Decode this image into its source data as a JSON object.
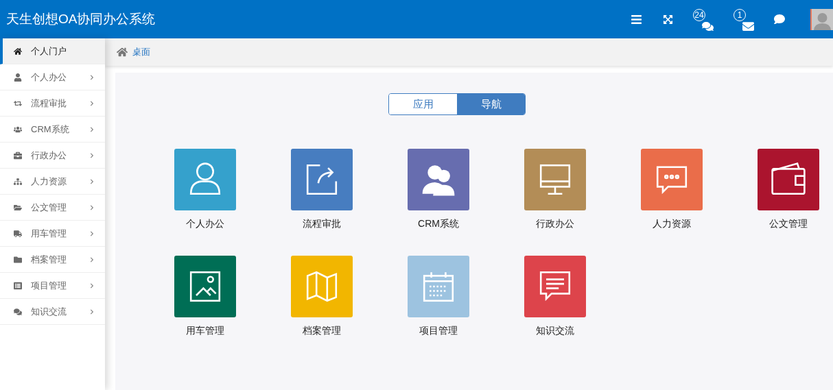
{
  "header": {
    "title": "天生创想OA协同办公系统",
    "badges": [
      {
        "count": "24"
      },
      {
        "count": "1"
      }
    ]
  },
  "sidebar": {
    "items": [
      {
        "label": "个人门户",
        "selected": true,
        "expandable": false
      },
      {
        "label": "个人办公",
        "selected": false,
        "expandable": true
      },
      {
        "label": "流程审批",
        "selected": false,
        "expandable": true
      },
      {
        "label": "CRM系统",
        "selected": false,
        "expandable": true
      },
      {
        "label": "行政办公",
        "selected": false,
        "expandable": true
      },
      {
        "label": "人力资源",
        "selected": false,
        "expandable": true
      },
      {
        "label": "公文管理",
        "selected": false,
        "expandable": true
      },
      {
        "label": "用车管理",
        "selected": false,
        "expandable": true
      },
      {
        "label": "档案管理",
        "selected": false,
        "expandable": true
      },
      {
        "label": "项目管理",
        "selected": false,
        "expandable": true
      },
      {
        "label": "知识交流",
        "selected": false,
        "expandable": true
      }
    ]
  },
  "breadcrumb": "桌面",
  "toggle": [
    {
      "label": "应用",
      "selected": false
    },
    {
      "label": "导航",
      "selected": true
    }
  ],
  "tiles": [
    {
      "label": "个人办公",
      "color": "#35a1cc"
    },
    {
      "label": "流程审批",
      "color": "#477dc0"
    },
    {
      "label": "CRM系统",
      "color": "#676daf"
    },
    {
      "label": "行政办公",
      "color": "#b38d57"
    },
    {
      "label": "人力资源",
      "color": "#ea6d4a"
    },
    {
      "label": "公文管理",
      "color": "#ab142e"
    },
    {
      "label": "用车管理",
      "color": "#006e55"
    },
    {
      "label": "档案管理",
      "color": "#f2b600"
    },
    {
      "label": "项目管理",
      "color": "#9dc3e0"
    },
    {
      "label": "知识交流",
      "color": "#dd444b"
    }
  ]
}
